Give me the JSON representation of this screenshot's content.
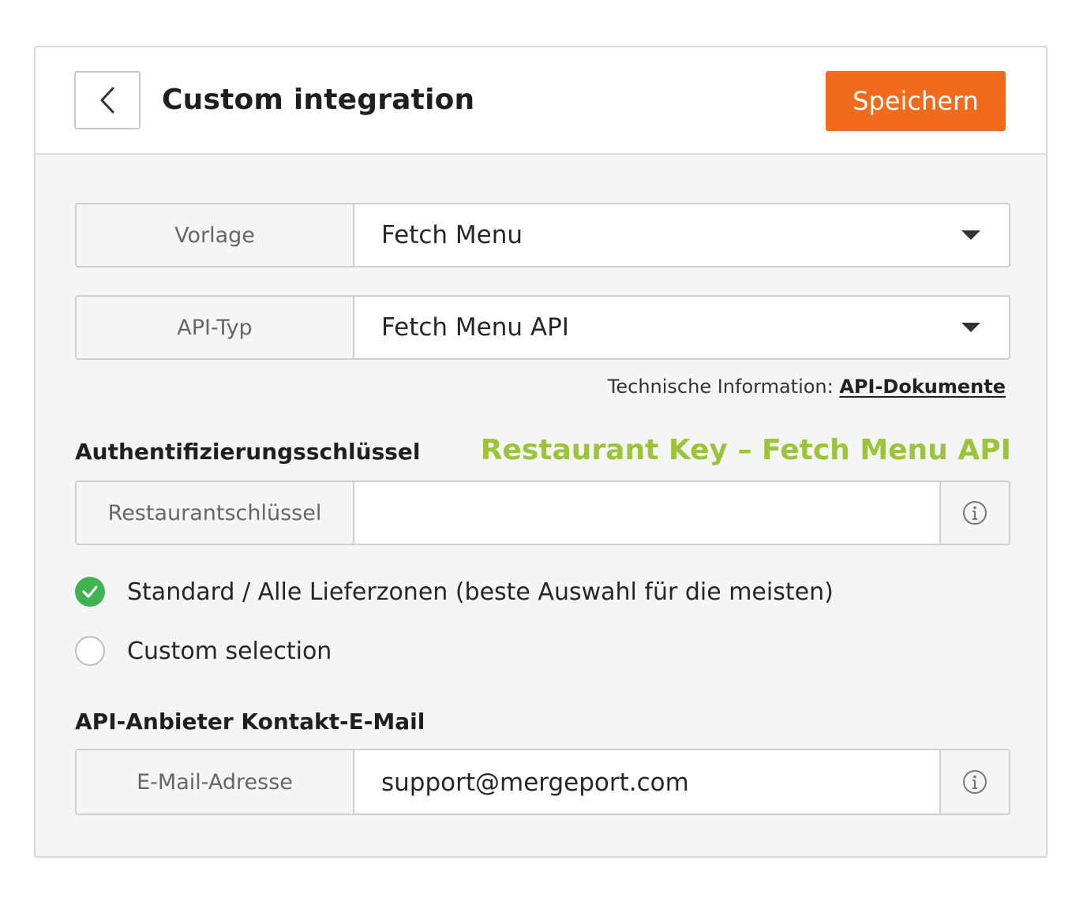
{
  "header": {
    "title": "Custom integration",
    "save_label": "Speichern"
  },
  "template_field": {
    "label": "Vorlage",
    "value": "Fetch Menu"
  },
  "api_type_field": {
    "label": "API-Typ",
    "value": "Fetch Menu API"
  },
  "tech_info": {
    "prefix": "Technische Information: ",
    "link_label": "API-Dokumente"
  },
  "auth_section": {
    "title": "Authentifizierungsschlüssel",
    "annotation": "Restaurant Key – Fetch Menu API",
    "key_label": "Restaurantschlüssel",
    "key_value": ""
  },
  "delivery_options": [
    {
      "label": "Standard / Alle Lieferzonen (beste Auswahl für die meisten)",
      "selected": true
    },
    {
      "label": "Custom selection",
      "selected": false
    }
  ],
  "contact_section": {
    "title": "API-Anbieter Kontakt-E-Mail",
    "email_label": "E-Mail-Adresse",
    "email_value": "support@mergeport.com"
  },
  "colors": {
    "accent": "#f26b1d",
    "success": "#3fb352",
    "annotation": "#9cc43a"
  },
  "icons": {
    "back": "chevron-left-icon",
    "dropdown": "caret-down-icon",
    "info": "info-circle-icon",
    "check": "check-icon"
  }
}
